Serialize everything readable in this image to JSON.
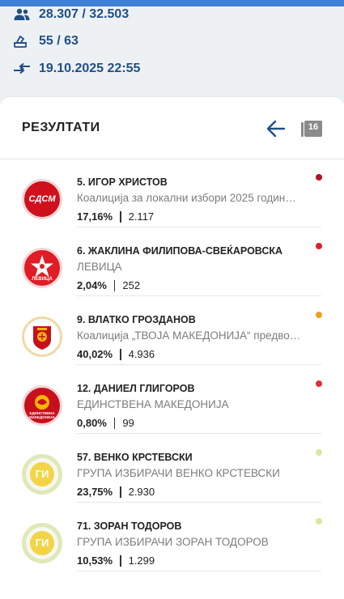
{
  "stats": {
    "voters": "28.307 / 32.503",
    "stations": "55 / 63",
    "updated": "19.10.2025 22:55"
  },
  "results": {
    "title": "РЕЗУЛТАТИ",
    "pages_badge": "16"
  },
  "candidates": [
    {
      "name": "5. ИГОР ХРИСТОВ",
      "party": "Коалиција за локални избори 2025 годин…",
      "percent": "17,16%",
      "votes": "2.117",
      "dot_color": "#b3121f",
      "logo": "sdsm-logo",
      "logo_text": "СДСМ"
    },
    {
      "name": "6. ЖАКЛИНА ФИЛИПОВА-СВЕЌАРОВСКА",
      "party": "ЛЕВИЦА",
      "percent": "2,04%",
      "votes": "252",
      "dot_color": "#e01c24",
      "logo": "levica-logo",
      "logo_text": "ЛЕВИЦА"
    },
    {
      "name": "9. ВЛАТКО ГРОЗДАНОВ",
      "party": "Коалиција „ТВОЈА МАКЕДОНИЈА“ предво…",
      "percent": "40,02%",
      "votes": "4.936",
      "dot_color": "#f0a020",
      "logo": "vmro-logo",
      "logo_text": ""
    },
    {
      "name": "12. ДАНИЕЛ ГЛИГОРОВ",
      "party": "ЕДИНСТВЕНА МАКЕДОНИЈА",
      "percent": "0,80%",
      "votes": "99",
      "dot_color": "#e0303a",
      "logo": "edinstvena-logo",
      "logo_text": "ЕДИНСТВЕНА МАКЕДОНИЈА"
    },
    {
      "name": "57. ВЕНКО КРСТЕВСКИ",
      "party": "ГРУПА ИЗБИРАЧИ ВЕНКО КРСТЕВСКИ",
      "percent": "23,75%",
      "votes": "2.930",
      "dot_color": "#d5eaa0",
      "logo": "gi-logo",
      "logo_text": "ГИ"
    },
    {
      "name": "71. ЗОРАН ТОДОРОВ",
      "party": "ГРУПА ИЗБИРАЧИ ЗОРАН ТОДОРОВ",
      "percent": "10,53%",
      "votes": "1.299",
      "dot_color": "#d5eaa0",
      "logo": "gi-logo",
      "logo_text": "ГИ"
    }
  ],
  "colors": {
    "accent": "#1f4f86",
    "sdsm": "#d0101c",
    "levica": "#e01c24",
    "vmro": "#c8101c",
    "gi_ring": "#dfe9b8"
  }
}
